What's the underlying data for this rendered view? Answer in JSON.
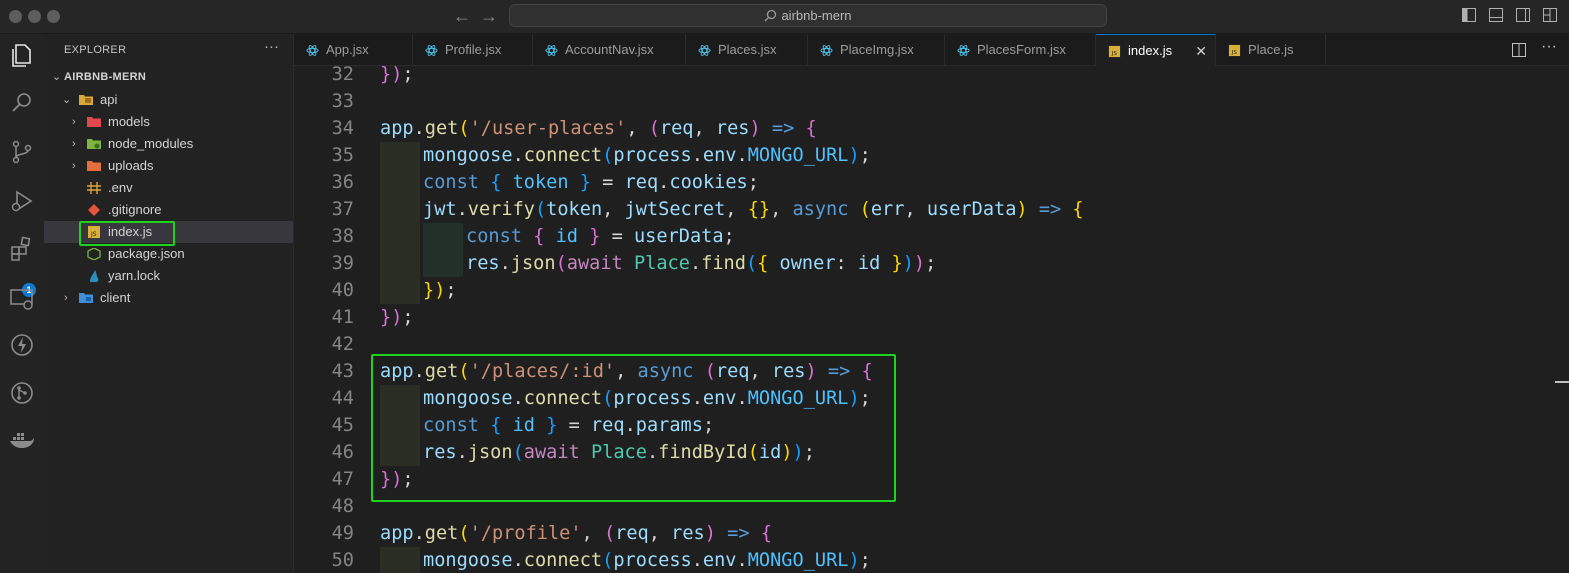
{
  "titlebar": {
    "search_text": "airbnb-mern",
    "icons": [
      "back-arrow",
      "forward-arrow",
      "search-icon",
      "toggle-primary-sidebar",
      "toggle-panel",
      "toggle-secondary-sidebar",
      "customize-layout"
    ]
  },
  "activity_bar": {
    "items": [
      "explorer",
      "search",
      "source-control",
      "run-and-debug",
      "extensions",
      "remote-explorer",
      "thunder-client",
      "git-graph",
      "docker"
    ],
    "extensions_badge": "1"
  },
  "sidebar": {
    "header": "EXPLORER",
    "more": "···",
    "root": "AIRBNB-MERN",
    "items": [
      {
        "label": "api",
        "type": "folder-open"
      },
      {
        "label": "models",
        "type": "folder"
      },
      {
        "label": "node_modules",
        "type": "folder"
      },
      {
        "label": "uploads",
        "type": "folder"
      },
      {
        "label": ".env",
        "type": "file"
      },
      {
        "label": ".gitignore",
        "type": "file"
      },
      {
        "label": "index.js",
        "type": "file",
        "active": true
      },
      {
        "label": "package.json",
        "type": "file"
      },
      {
        "label": "yarn.lock",
        "type": "file"
      },
      {
        "label": "client",
        "type": "folder"
      }
    ]
  },
  "tabs": [
    {
      "label": "App.jsx"
    },
    {
      "label": "Profile.jsx"
    },
    {
      "label": "AccountNav.jsx"
    },
    {
      "label": "Places.jsx"
    },
    {
      "label": "PlaceImg.jsx"
    },
    {
      "label": "PlacesForm.jsx"
    },
    {
      "label": "index.js",
      "active": true
    },
    {
      "label": "Place.js"
    }
  ],
  "tab_close": "✕",
  "editor": {
    "line_numbers": [
      "32",
      "33",
      "34",
      "35",
      "36",
      "37",
      "38",
      "39",
      "40",
      "41",
      "42",
      "43",
      "44",
      "45",
      "46",
      "47",
      "48",
      "49",
      "50"
    ],
    "lines": [
      [
        [
          "b2",
          "})"
        ],
        [
          "t-pun",
          ";"
        ]
      ],
      [],
      [
        [
          "t-var",
          "app"
        ],
        [
          "t-pun",
          "."
        ],
        [
          "t-fn",
          "get"
        ],
        [
          "b1",
          "("
        ],
        [
          "t-str",
          "'/user-places'"
        ],
        [
          "t-pun",
          ", "
        ],
        [
          "b2",
          "("
        ],
        [
          "t-var",
          "req"
        ],
        [
          "t-pun",
          ", "
        ],
        [
          "t-var",
          "res"
        ],
        [
          "b2",
          ")"
        ],
        [
          "t-pun",
          " "
        ],
        [
          "t-kw",
          "=>"
        ],
        [
          "t-pun",
          " "
        ],
        [
          "b2",
          "{"
        ]
      ],
      [
        [
          "t-var",
          "mongoose"
        ],
        [
          "t-pun",
          "."
        ],
        [
          "t-fn",
          "connect"
        ],
        [
          "b3",
          "("
        ],
        [
          "t-var",
          "process"
        ],
        [
          "t-pun",
          "."
        ],
        [
          "t-var",
          "env"
        ],
        [
          "t-pun",
          "."
        ],
        [
          "t-const",
          "MONGO_URL"
        ],
        [
          "b3",
          ")"
        ],
        [
          "t-pun",
          ";"
        ]
      ],
      [
        [
          "t-kw",
          "const"
        ],
        [
          "t-pun",
          " "
        ],
        [
          "b3",
          "{"
        ],
        [
          "t-pun",
          " "
        ],
        [
          "t-const",
          "token"
        ],
        [
          "t-pun",
          " "
        ],
        [
          "b3",
          "}"
        ],
        [
          "t-pun",
          " = "
        ],
        [
          "t-var",
          "req"
        ],
        [
          "t-pun",
          "."
        ],
        [
          "t-var",
          "cookies"
        ],
        [
          "t-pun",
          ";"
        ]
      ],
      [
        [
          "t-var",
          "jwt"
        ],
        [
          "t-pun",
          "."
        ],
        [
          "t-fn",
          "verify"
        ],
        [
          "b3",
          "("
        ],
        [
          "t-var",
          "token"
        ],
        [
          "t-pun",
          ", "
        ],
        [
          "t-var",
          "jwtSecret"
        ],
        [
          "t-pun",
          ", "
        ],
        [
          "b1",
          "{}"
        ],
        [
          "t-pun",
          ", "
        ],
        [
          "t-kw",
          "async"
        ],
        [
          "t-pun",
          " "
        ],
        [
          "b1",
          "("
        ],
        [
          "t-var",
          "err"
        ],
        [
          "t-pun",
          ", "
        ],
        [
          "t-var",
          "userData"
        ],
        [
          "b1",
          ")"
        ],
        [
          "t-pun",
          " "
        ],
        [
          "t-kw",
          "=>"
        ],
        [
          "t-pun",
          " "
        ],
        [
          "b1",
          "{"
        ]
      ],
      [
        [
          "t-kw",
          "const"
        ],
        [
          "t-pun",
          " "
        ],
        [
          "b2",
          "{"
        ],
        [
          "t-pun",
          " "
        ],
        [
          "t-const",
          "id"
        ],
        [
          "t-pun",
          " "
        ],
        [
          "b2",
          "}"
        ],
        [
          "t-pun",
          " = "
        ],
        [
          "t-var",
          "userData"
        ],
        [
          "t-pun",
          ";"
        ]
      ],
      [
        [
          "t-var",
          "res"
        ],
        [
          "t-pun",
          "."
        ],
        [
          "t-fn",
          "json"
        ],
        [
          "b2",
          "("
        ],
        [
          "t-ctl",
          "await"
        ],
        [
          "t-pun",
          " "
        ],
        [
          "t-cls",
          "Place"
        ],
        [
          "t-pun",
          "."
        ],
        [
          "t-fn",
          "find"
        ],
        [
          "b3",
          "("
        ],
        [
          "b1",
          "{"
        ],
        [
          "t-pun",
          " "
        ],
        [
          "t-var",
          "owner"
        ],
        [
          "t-pun",
          ": "
        ],
        [
          "t-var",
          "id"
        ],
        [
          "t-pun",
          " "
        ],
        [
          "b1",
          "}"
        ],
        [
          "b3",
          ")"
        ],
        [
          "b2",
          ")"
        ],
        [
          "t-pun",
          ";"
        ]
      ],
      [
        [
          "b1",
          "})"
        ],
        [
          "t-pun",
          ";"
        ]
      ],
      [
        [
          "b2",
          "})"
        ],
        [
          "t-pun",
          ";"
        ]
      ],
      [],
      [
        [
          "t-var",
          "app"
        ],
        [
          "t-pun",
          "."
        ],
        [
          "t-fn",
          "get"
        ],
        [
          "b1",
          "("
        ],
        [
          "t-str",
          "'/places/:id'"
        ],
        [
          "t-pun",
          ", "
        ],
        [
          "t-kw",
          "async"
        ],
        [
          "t-pun",
          " "
        ],
        [
          "b2",
          "("
        ],
        [
          "t-var",
          "req"
        ],
        [
          "t-pun",
          ", "
        ],
        [
          "t-var",
          "res"
        ],
        [
          "b2",
          ")"
        ],
        [
          "t-pun",
          " "
        ],
        [
          "t-kw",
          "=>"
        ],
        [
          "t-pun",
          " "
        ],
        [
          "b2",
          "{"
        ]
      ],
      [
        [
          "t-var",
          "mongoose"
        ],
        [
          "t-pun",
          "."
        ],
        [
          "t-fn",
          "connect"
        ],
        [
          "b3",
          "("
        ],
        [
          "t-var",
          "process"
        ],
        [
          "t-pun",
          "."
        ],
        [
          "t-var",
          "env"
        ],
        [
          "t-pun",
          "."
        ],
        [
          "t-const",
          "MONGO_URL"
        ],
        [
          "b3",
          ")"
        ],
        [
          "t-pun",
          ";"
        ]
      ],
      [
        [
          "t-kw",
          "const"
        ],
        [
          "t-pun",
          " "
        ],
        [
          "b3",
          "{"
        ],
        [
          "t-pun",
          " "
        ],
        [
          "t-const",
          "id"
        ],
        [
          "t-pun",
          " "
        ],
        [
          "b3",
          "}"
        ],
        [
          "t-pun",
          " = "
        ],
        [
          "t-var",
          "req"
        ],
        [
          "t-pun",
          "."
        ],
        [
          "t-var",
          "params"
        ],
        [
          "t-pun",
          ";"
        ]
      ],
      [
        [
          "t-var",
          "res"
        ],
        [
          "t-pun",
          "."
        ],
        [
          "t-fn",
          "json"
        ],
        [
          "b3",
          "("
        ],
        [
          "t-ctl",
          "await"
        ],
        [
          "t-pun",
          " "
        ],
        [
          "t-cls",
          "Place"
        ],
        [
          "t-pun",
          "."
        ],
        [
          "t-fn",
          "findById"
        ],
        [
          "b1",
          "("
        ],
        [
          "t-var",
          "id"
        ],
        [
          "b1",
          ")"
        ],
        [
          "b3",
          ")"
        ],
        [
          "t-pun",
          ";"
        ]
      ],
      [
        [
          "b2",
          "})"
        ],
        [
          "t-pun",
          ";"
        ]
      ],
      [],
      [
        [
          "t-var",
          "app"
        ],
        [
          "t-pun",
          "."
        ],
        [
          "t-fn",
          "get"
        ],
        [
          "b1",
          "("
        ],
        [
          "t-str",
          "'/profile'"
        ],
        [
          "t-pun",
          ", "
        ],
        [
          "b2",
          "("
        ],
        [
          "t-var",
          "req"
        ],
        [
          "t-pun",
          ", "
        ],
        [
          "t-var",
          "res"
        ],
        [
          "b2",
          ")"
        ],
        [
          "t-pun",
          " "
        ],
        [
          "t-kw",
          "=>"
        ],
        [
          "t-pun",
          " "
        ],
        [
          "b2",
          "{"
        ]
      ],
      [
        [
          "t-var",
          "mongoose"
        ],
        [
          "t-pun",
          "."
        ],
        [
          "t-fn",
          "connect"
        ],
        [
          "b3",
          "("
        ],
        [
          "t-var",
          "process"
        ],
        [
          "t-pun",
          "."
        ],
        [
          "t-var",
          "env"
        ],
        [
          "t-pun",
          "."
        ],
        [
          "t-const",
          "MONGO_URL"
        ],
        [
          "b3",
          ")"
        ],
        [
          "t-pun",
          ";"
        ]
      ]
    ]
  },
  "colors": {
    "highlight_box": "#1ed31e",
    "accent": "#0078d4",
    "badge": "#0e7ad3"
  }
}
